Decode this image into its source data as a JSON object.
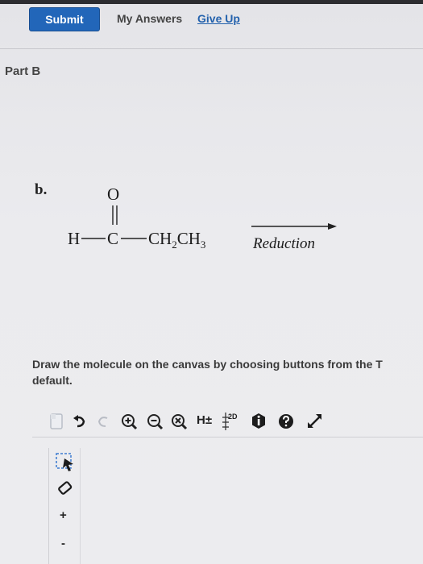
{
  "header": {
    "submit_label": "Submit",
    "my_answers_label": "My Answers",
    "give_up_label": "Give Up"
  },
  "part": {
    "title": "Part B"
  },
  "question": {
    "label": "b.",
    "reagent_label": "Reduction",
    "molecule": {
      "h": "H",
      "c": "C",
      "o": "O",
      "group": "CH",
      "sub2": "2",
      "group2": "CH",
      "sub3": "3"
    }
  },
  "instructions": "Draw the molecule on the canvas by choosing buttons from the T default.",
  "toolbar": {
    "h_plus_label": "H±",
    "two_d_label": "2D"
  },
  "side_tools": {
    "plus_label": "+",
    "minus_label": "-"
  },
  "colors": {
    "submit_bg": "#2266b9",
    "link": "#2462ad"
  }
}
